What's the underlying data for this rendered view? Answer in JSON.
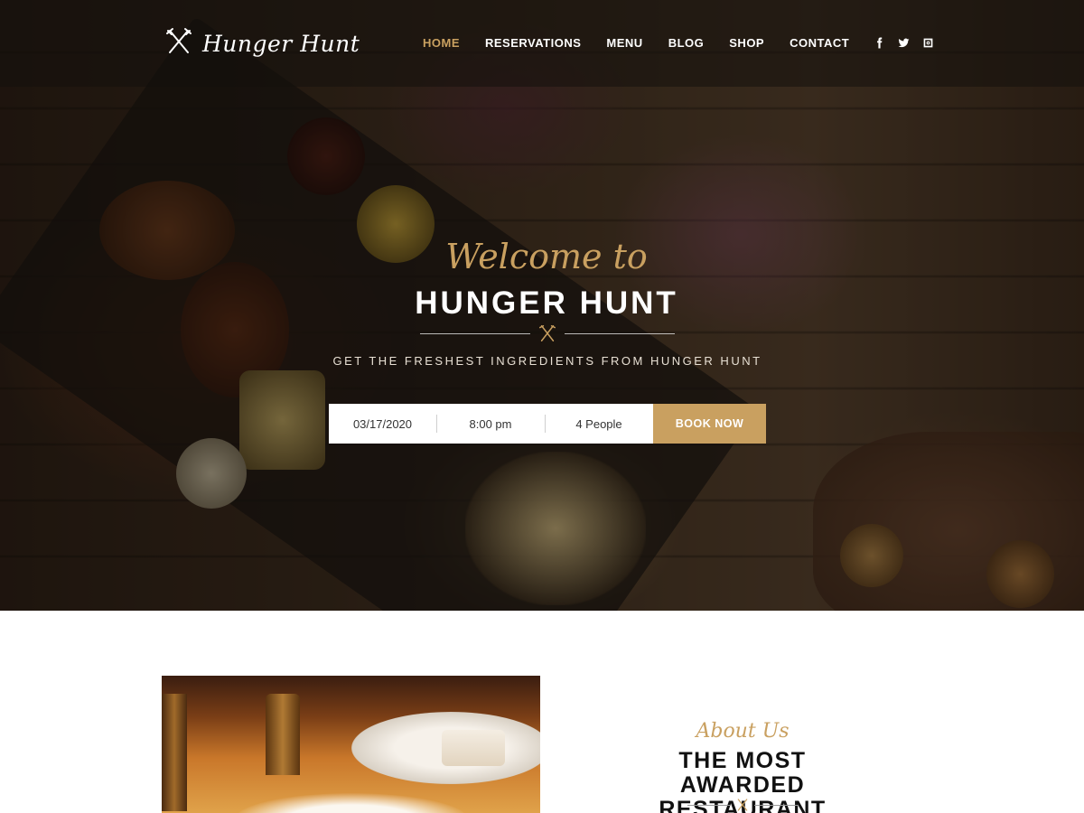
{
  "brand": {
    "name": "Hunger Hunt",
    "icon": "fork-knife-icon"
  },
  "nav": {
    "items": [
      {
        "label": "HOME",
        "active": true
      },
      {
        "label": "RESERVATIONS",
        "active": false
      },
      {
        "label": "MENU",
        "active": false
      },
      {
        "label": "BLOG",
        "active": false
      },
      {
        "label": "SHOP",
        "active": false
      },
      {
        "label": "CONTACT",
        "active": false
      }
    ]
  },
  "social": [
    {
      "icon": "facebook-icon"
    },
    {
      "icon": "twitter-icon"
    },
    {
      "icon": "instagram-icon"
    }
  ],
  "hero": {
    "script": "Welcome to",
    "title": "HUNGER HUNT",
    "tagline": "GET THE FRESHEST INGREDIENTS FROM HUNGER HUNT"
  },
  "booking": {
    "date": "03/17/2020",
    "time": "8:00 pm",
    "people": "4 People",
    "button": "BOOK NOW"
  },
  "about": {
    "script": "About Us",
    "heading_line1": "THE MOST AWARDED",
    "heading_line2": "RESTAURANT"
  },
  "colors": {
    "accent": "#c9a060",
    "header_bg": "#14100c",
    "text_dark": "#111111",
    "white": "#ffffff"
  }
}
